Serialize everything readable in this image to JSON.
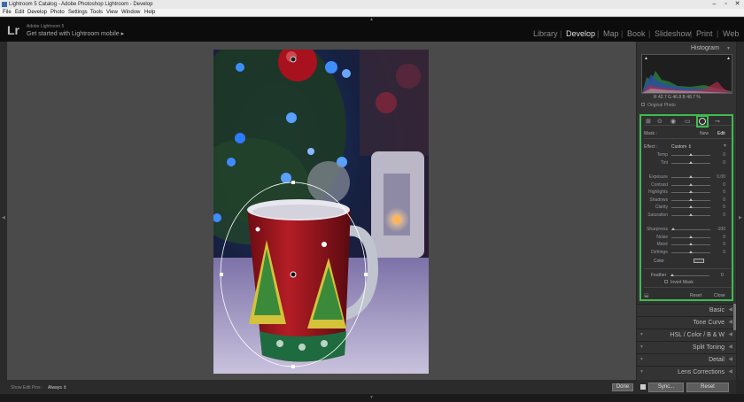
{
  "window": {
    "title": "Lightroom 5 Catalog - Adobe Photoshop Lightroom - Develop"
  },
  "menu": [
    "File",
    "Edit",
    "Develop",
    "Photo",
    "Settings",
    "Tools",
    "View",
    "Window",
    "Help"
  ],
  "identity": {
    "logo": "Lr",
    "app_name": "Adobe Lightroom 5",
    "mobile_prompt": "Get started with Lightroom mobile ▸"
  },
  "modules": [
    {
      "label": "Library",
      "active": false
    },
    {
      "label": "Develop",
      "active": true
    },
    {
      "label": "Map",
      "active": false
    },
    {
      "label": "Book",
      "active": false
    },
    {
      "label": "Slideshow",
      "active": false
    },
    {
      "label": "Print",
      "active": false
    },
    {
      "label": "Web",
      "active": false
    }
  ],
  "histogram": {
    "title": "Histogram",
    "readout": "R 42.7  G 46.8  B 48.7 %",
    "original_photo": "Original Photo"
  },
  "radial_filter": {
    "mask_label": "Mask :",
    "new_label": "New",
    "edit_label": "Edit",
    "effect_label": "Effect :",
    "effect_value": "Custom ⇕",
    "sliders": [
      {
        "label": "Temp",
        "value": "0",
        "pos": 0.5
      },
      {
        "label": "Tint",
        "value": "0",
        "pos": 0.5
      },
      {
        "label": "Exposure",
        "value": "0.00",
        "pos": 0.5
      },
      {
        "label": "Contrast",
        "value": "0",
        "pos": 0.5
      },
      {
        "label": "Highlights",
        "value": "0",
        "pos": 0.5
      },
      {
        "label": "Shadows",
        "value": "0",
        "pos": 0.5
      },
      {
        "label": "Clarity",
        "value": "0",
        "pos": 0.5
      },
      {
        "label": "Saturation",
        "value": "0",
        "pos": 0.5
      },
      {
        "label": "Sharpness",
        "value": "-100",
        "pos": 0.05
      },
      {
        "label": "Noise",
        "value": "0",
        "pos": 0.5
      },
      {
        "label": "Moiré",
        "value": "0",
        "pos": 0.5
      },
      {
        "label": "Defringe",
        "value": "0",
        "pos": 0.5
      }
    ],
    "color_label": "Color",
    "feather_label": "Feather",
    "feather_value": "0",
    "feather_pos": 0.05,
    "invert_mask": "Invert Mask",
    "reset": "Reset",
    "close": "Close"
  },
  "panels": [
    "Basic",
    "Tone Curve",
    "HSL / Color / B & W",
    "Split Toning",
    "Detail",
    "Lens Corrections"
  ],
  "toolbar": {
    "show_edit_pins_label": "Show Edit Pins :",
    "show_edit_pins_value": "Always ⇕",
    "done": "Done"
  },
  "sync": {
    "sync": "Sync...",
    "reset": "Reset"
  },
  "colors": {
    "highlight": "#3ebc50",
    "accent": "#e0e0e0"
  }
}
